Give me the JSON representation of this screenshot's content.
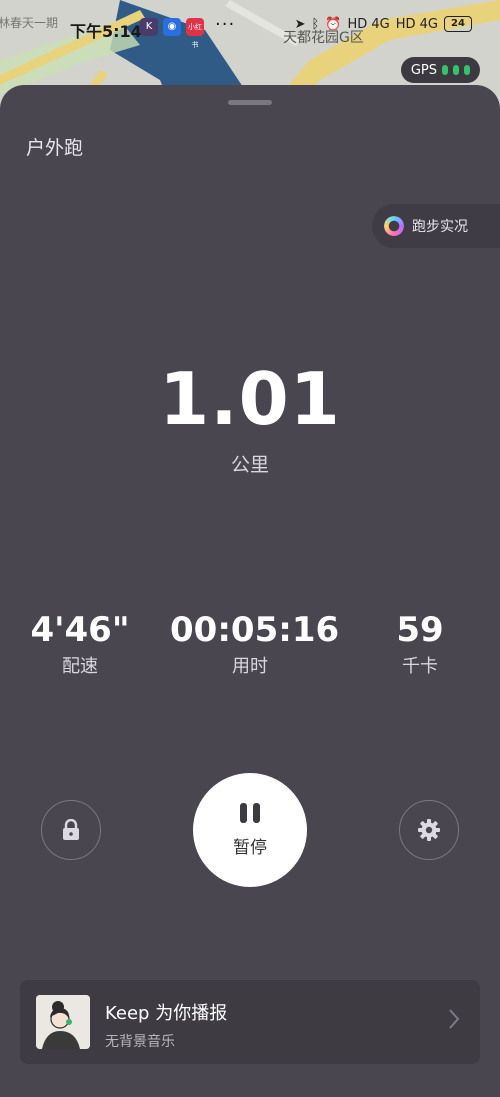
{
  "status_bar": {
    "time": "下午5:14",
    "app_icons": [
      "K",
      "maps",
      "小红书"
    ],
    "more": "···",
    "network_1": "HD 4G",
    "network_2": "HD 4G",
    "battery": "24"
  },
  "map": {
    "label": "天都花园G区",
    "edge_label": "林春天一期",
    "gps_label": "GPS"
  },
  "panel": {
    "mode_title": "户外跑",
    "live_button": "跑步实况",
    "distance": {
      "value": "1.01",
      "unit": "公里"
    },
    "stats": [
      {
        "value": "4'46\"",
        "label": "配速"
      },
      {
        "value": "00:05:16",
        "label": "用时"
      },
      {
        "value": "59",
        "label": "千卡"
      }
    ],
    "pause_label": "暂停",
    "lock_icon": "lock-icon",
    "settings_icon": "gear-icon"
  },
  "voice": {
    "title": "Keep 为你播报",
    "subtitle": "无背景音乐"
  },
  "colors": {
    "panel_bg": "#4a4650",
    "gps_dot": "#34c36a",
    "pause_bg": "#ffffff"
  }
}
